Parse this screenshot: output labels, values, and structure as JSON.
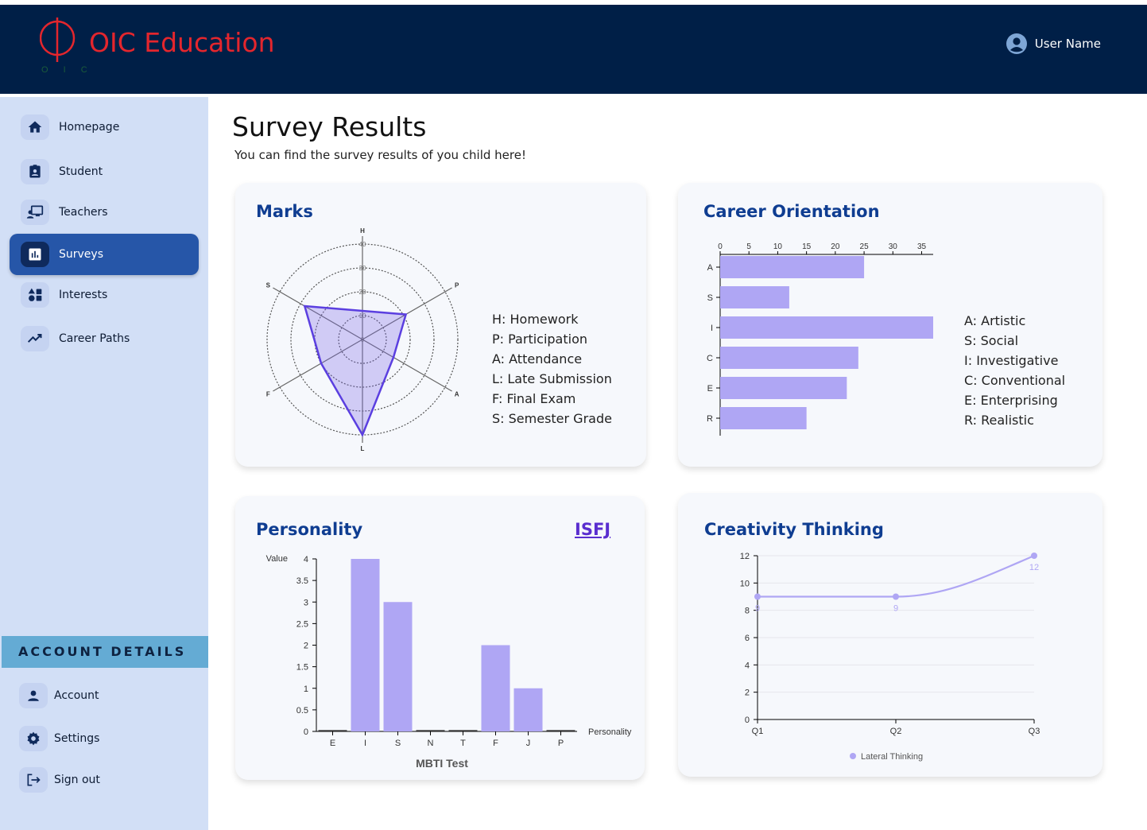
{
  "app": {
    "brand": "OIC Education",
    "logo_small": "O I C",
    "user_name": "User Name"
  },
  "colors": {
    "header": "#001f47",
    "brand_red": "#e4262d",
    "sidebar": "#d2dff6",
    "active": "#2656a8",
    "accent_title": "#0f3d91",
    "bar": "#afa6f4",
    "radar_stroke": "#5b3fe0"
  },
  "sidebar": {
    "items": [
      {
        "label": "Homepage",
        "icon": "home-icon"
      },
      {
        "label": "Student",
        "icon": "student-badge-icon"
      },
      {
        "label": "Teachers",
        "icon": "teacher-board-icon"
      },
      {
        "label": "Surveys",
        "icon": "bar-chart-icon",
        "active": true
      },
      {
        "label": "Interests",
        "icon": "shapes-icon"
      },
      {
        "label": "Career Paths",
        "icon": "trending-up-icon"
      }
    ],
    "account_header": "ACCOUNT DETAILS",
    "account_items": [
      {
        "label": "Account",
        "icon": "person-icon"
      },
      {
        "label": "Settings",
        "icon": "gear-icon"
      },
      {
        "label": "Sign out",
        "icon": "logout-icon"
      }
    ]
  },
  "page": {
    "title": "Survey Results",
    "subtitle": "You can find the survey results of you child here!"
  },
  "cards": {
    "marks": {
      "title": "Marks",
      "legend": [
        "H: Homework",
        "P: Participation",
        "A: Attendance",
        "L: Late Submission",
        "F: Final Exam",
        "S: Semester Grade"
      ]
    },
    "career": {
      "title": "Career Orientation",
      "legend": [
        "A: Artistic",
        "S: Social",
        "I: Investigative",
        "C: Conventional",
        "E: Enterprising",
        "R: Realistic"
      ]
    },
    "personality": {
      "title": "Personality",
      "result": "ISFJ"
    },
    "creativity": {
      "title": "Creativity Thinking"
    }
  },
  "chart_data": [
    {
      "type": "radar",
      "categories": [
        "H",
        "P",
        "A",
        "L",
        "F",
        "S"
      ],
      "values": [
        12,
        21,
        15,
        40,
        20,
        28
      ],
      "ticks": [
        0,
        10,
        20,
        30,
        40
      ],
      "range": [
        0,
        40
      ]
    },
    {
      "type": "bar",
      "orientation": "horizontal",
      "categories": [
        "A",
        "S",
        "I",
        "C",
        "E",
        "R"
      ],
      "values": [
        25,
        12,
        37,
        24,
        22,
        15
      ],
      "xticks": [
        0,
        5,
        10,
        15,
        20,
        25,
        30,
        35
      ],
      "xlim": [
        0,
        37
      ]
    },
    {
      "type": "bar",
      "categories": [
        "E",
        "I",
        "S",
        "N",
        "T",
        "F",
        "J",
        "P"
      ],
      "values": [
        0,
        4,
        3,
        0,
        0,
        2,
        1,
        0
      ],
      "ylabel": "Value",
      "xlabel": "Personality",
      "title": "MBTI Test",
      "yticks": [
        "0",
        "0.5",
        "1",
        "1.5",
        "2",
        "2.5",
        "3",
        "3.5",
        "4"
      ],
      "ylim": [
        0,
        4
      ]
    },
    {
      "type": "line",
      "categories": [
        "Q1",
        "Q2",
        "Q3"
      ],
      "series": [
        {
          "name": "Lateral Thinking",
          "values": [
            9,
            9,
            12
          ]
        }
      ],
      "yticks": [
        0,
        2,
        4,
        6,
        8,
        10,
        12
      ],
      "ylim": [
        0,
        12
      ]
    }
  ]
}
